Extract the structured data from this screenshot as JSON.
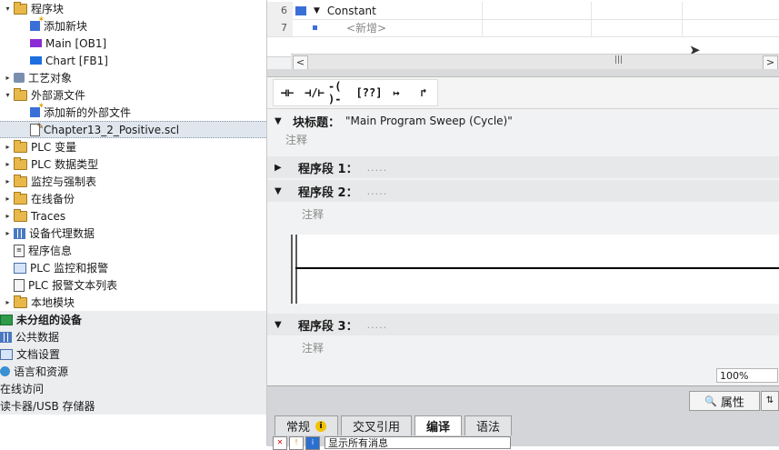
{
  "tree": {
    "items": [
      {
        "label": "程序块",
        "icon": "folder-icon",
        "twisty": "▾",
        "indent": 0
      },
      {
        "label": "添加新块",
        "icon": "add-block-icon",
        "twisty": "",
        "indent": 1
      },
      {
        "label": "Main [OB1]",
        "icon": "ob-block-icon",
        "twisty": "",
        "indent": 1
      },
      {
        "label": "Chart [FB1]",
        "icon": "fb-block-icon",
        "twisty": "",
        "indent": 1
      },
      {
        "label": "工艺对象",
        "icon": "technology-icon",
        "twisty": "▸",
        "indent": 0
      },
      {
        "label": "外部源文件",
        "icon": "source-folder-icon",
        "twisty": "▾",
        "indent": 0
      },
      {
        "label": "添加新的外部文件",
        "icon": "add-file-icon",
        "twisty": "",
        "indent": 1
      },
      {
        "label": "Chapter13_2_Positive.scl",
        "icon": "scl-file-icon",
        "twisty": "",
        "indent": 1
      },
      {
        "label": "PLC 变量",
        "icon": "folder-icon",
        "twisty": "▸",
        "indent": 0
      },
      {
        "label": "PLC 数据类型",
        "icon": "folder-icon",
        "twisty": "▸",
        "indent": 0
      },
      {
        "label": "监控与强制表",
        "icon": "folder-icon",
        "twisty": "▸",
        "indent": 0
      },
      {
        "label": "在线备份",
        "icon": "folder-icon",
        "twisty": "▸",
        "indent": 0
      },
      {
        "label": "Traces",
        "icon": "folder-icon",
        "twisty": "▸",
        "indent": 0
      },
      {
        "label": "设备代理数据",
        "icon": "proxy-icon",
        "twisty": "▸",
        "indent": 0
      },
      {
        "label": "程序信息",
        "icon": "program-info-icon",
        "twisty": "",
        "indent": 0
      },
      {
        "label": "PLC 监控和报警",
        "icon": "alarm-icon",
        "twisty": "",
        "indent": 0
      },
      {
        "label": "PLC 报警文本列表",
        "icon": "text-list-icon",
        "twisty": "",
        "indent": 0
      },
      {
        "label": "本地模块",
        "icon": "folder-icon",
        "twisty": "▸",
        "indent": 0
      },
      {
        "label": "未分组的设备",
        "icon": "device-icon",
        "twisty": "",
        "indent": -1
      },
      {
        "label": "公共数据",
        "icon": "common-data-icon",
        "twisty": "",
        "indent": -1
      },
      {
        "label": "文档设置",
        "icon": "doc-settings-icon",
        "twisty": "",
        "indent": -1
      },
      {
        "label": "语言和资源",
        "icon": "language-icon",
        "twisty": "",
        "indent": -1
      },
      {
        "label": "在线访问",
        "icon": "",
        "twisty": "",
        "indent": -2
      },
      {
        "label": "读卡器/USB 存储器",
        "icon": "",
        "twisty": "",
        "indent": -2
      }
    ]
  },
  "decl": {
    "rows": [
      {
        "num": "6",
        "name": "Constant"
      },
      {
        "num": "7",
        "name": "<新增>"
      }
    ]
  },
  "scroll": {
    "left": "<",
    "right": ">",
    "grip": "|||"
  },
  "toolbar": {
    "items": [
      "⊣⊢",
      "⊣/⊢",
      "-( )-",
      "[??]",
      "↦",
      "↱"
    ]
  },
  "block": {
    "title_label": "块标题：",
    "title_value": "\"Main Program Sweep (Cycle)\"",
    "comment": "注释"
  },
  "networks": [
    {
      "label": "程序段 1：",
      "dots": ".....",
      "caret": "▶"
    },
    {
      "label": "程序段 2：",
      "dots": ".....",
      "caret": "▼",
      "comment": "注释"
    },
    {
      "label": "程序段 3：",
      "dots": ".....",
      "caret": "▼",
      "comment": "注释"
    }
  ],
  "zoom": "100%",
  "bottom": {
    "properties_label": "属性",
    "tabs": [
      "常规",
      "交叉引用",
      "编译",
      "语法"
    ],
    "active_tab": "编译",
    "filter_text": "显示所有消息"
  }
}
